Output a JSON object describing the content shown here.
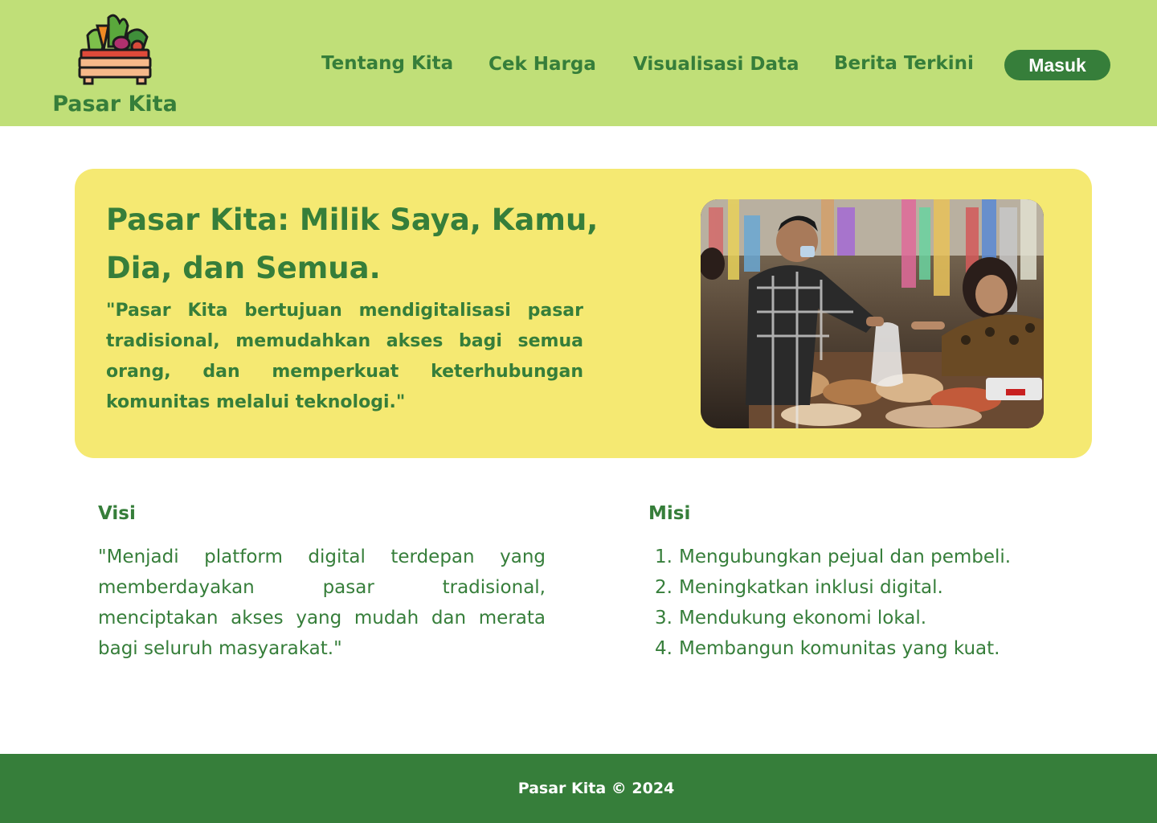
{
  "brand": {
    "name": "Pasar Kita",
    "logo_icon": "vegetable-crate-icon"
  },
  "nav": {
    "items": [
      {
        "label": "Tentang Kita"
      },
      {
        "label": "Cek Harga"
      },
      {
        "label": "Visualisasi Data"
      },
      {
        "label": "Berita Terkini"
      }
    ],
    "login_label": "Masuk"
  },
  "hero": {
    "title": "Pasar Kita: Milik Saya, Kamu, Dia, dan Semua.",
    "quote": "\"Pasar Kita bertujuan mendigitalisasi pasar tradisional, memudahkan akses bagi semua orang, dan memperkuat keterhubungan komunitas melalui teknologi.\"",
    "photo_icon": "market-vendor-photo"
  },
  "visi": {
    "title": "Visi",
    "text": "\"Menjadi platform digital terdepan yang memberdayakan pasar tradisional, menciptakan akses yang mudah dan merata bagi seluruh masyarakat.\""
  },
  "misi": {
    "title": "Misi",
    "items": [
      {
        "num": "1.",
        "text": "Mengubungkan pejual dan pembeli."
      },
      {
        "num": "2.",
        "text": "Meningkatkan inklusi digital."
      },
      {
        "num": "3.",
        "text": "Mendukung ekonomi lokal."
      },
      {
        "num": "4.",
        "text": "Membangun komunitas yang kuat."
      }
    ]
  },
  "footer": {
    "text": "Pasar Kita © 2024"
  },
  "colors": {
    "header_bg": "#c0df78",
    "primary_green": "#367e3a",
    "hero_bg": "#f5e972"
  }
}
